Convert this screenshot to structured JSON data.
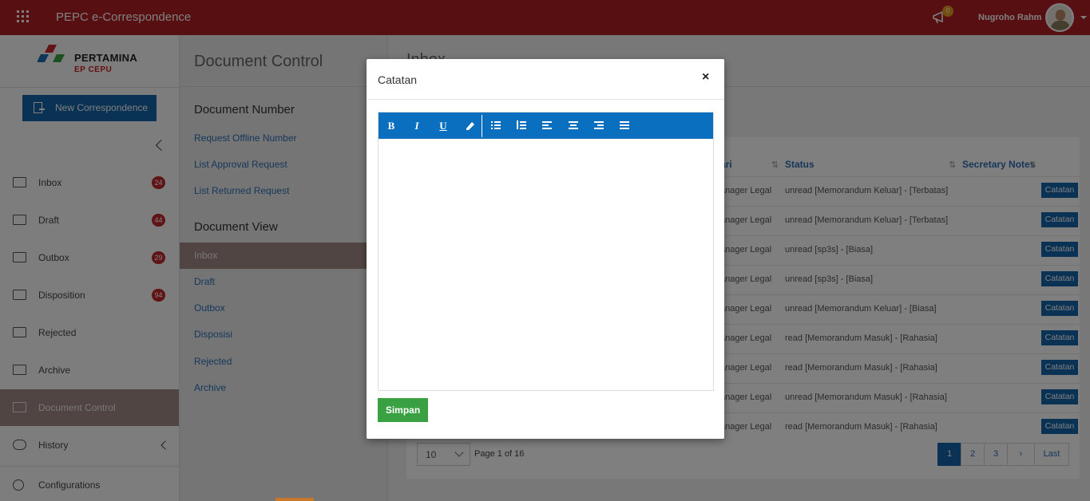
{
  "header": {
    "app_title": "PEPC e-Correspondence",
    "notification_count": "0",
    "user_name": "Nugroho Rahm"
  },
  "sidebar": {
    "logo_name": "PERTAMINA",
    "logo_sub": "EP CEPU",
    "new_button": "New Correspondence",
    "items": [
      {
        "label": "Inbox",
        "badge": "24",
        "icon": "inbox-icon"
      },
      {
        "label": "Draft",
        "badge": "44",
        "icon": "draft-icon"
      },
      {
        "label": "Outbox",
        "badge": "29",
        "icon": "outbox-icon"
      },
      {
        "label": "Disposition",
        "badge": "94",
        "icon": "disposition-icon"
      },
      {
        "label": "Rejected",
        "badge": "",
        "icon": "rejected-icon"
      },
      {
        "label": "Archive",
        "badge": "",
        "icon": "archive-icon"
      },
      {
        "label": "Document Control",
        "badge": "",
        "icon": "document-control-icon"
      },
      {
        "label": "History",
        "badge": "",
        "icon": "history-icon"
      },
      {
        "label": "Configurations",
        "badge": "",
        "icon": "gear-icon"
      }
    ]
  },
  "doc_control": {
    "title": "Document Control",
    "number_section": "Document Number",
    "number_links": [
      "Request Offline Number",
      "List Approval Request",
      "List Returned Request"
    ],
    "view_section": "Document View",
    "view_links": [
      "Inbox",
      "Draft",
      "Outbox",
      "Disposisi",
      "Rejected",
      "Archive"
    ]
  },
  "main": {
    "title": "Inbox",
    "columns": {
      "dari": "ari",
      "status": "Status",
      "notes": "Secretary Notes"
    },
    "rows": [
      {
        "dari": "anager Legal",
        "status": "unread [Memorandum Keluar] - [Terbatas]",
        "action": "Catatan"
      },
      {
        "dari": "anager Legal",
        "status": "unread [Memorandum Keluar] - [Terbatas]",
        "action": "Catatan"
      },
      {
        "dari": "anager Legal",
        "status": "unread [sp3s] - [Biasa]",
        "action": "Catatan"
      },
      {
        "dari": "anager Legal",
        "status": "unread [sp3s] - [Biasa]",
        "action": "Catatan"
      },
      {
        "dari": "anager Legal",
        "status": "unread [Memorandum Keluar] - [Biasa]",
        "action": "Catatan"
      },
      {
        "dari": "anager Legal",
        "status": "read [Memorandum Masuk] - [Rahasia]",
        "action": "Catatan"
      },
      {
        "dari": "anager Legal",
        "status": "read [Memorandum Masuk] - [Rahasia]",
        "action": "Catatan"
      },
      {
        "dari": "anager Legal",
        "status": "unread [Memorandum Masuk] - [Rahasia]",
        "action": "Catatan"
      },
      {
        "dari": "anager Legal",
        "status": "read [Memorandum Masuk] - [Rahasia]",
        "action": "Catatan"
      }
    ],
    "page_size": "10",
    "page_info": "Page 1 of 16",
    "pages": [
      "1",
      "2",
      "3"
    ],
    "last_label": "Last"
  },
  "modal": {
    "title": "Catatan",
    "close": "×",
    "save_label": "Simpan",
    "toolbar": {
      "bold": "B",
      "italic": "I",
      "underline": "U"
    }
  }
}
